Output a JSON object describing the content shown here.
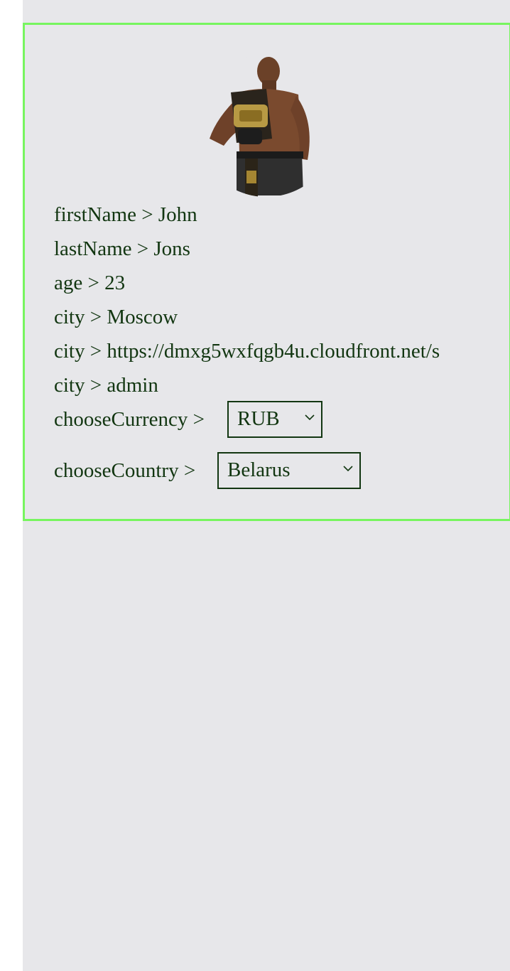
{
  "profile": {
    "fields": [
      {
        "key": "firstName",
        "value": "John"
      },
      {
        "key": "lastName",
        "value": "Jons"
      },
      {
        "key": "age",
        "value": "23"
      },
      {
        "key": "city",
        "value": "Moscow"
      },
      {
        "key": "city",
        "value": "https://dmxg5wxfqgb4u.cloudfront.net/s"
      },
      {
        "key": "city",
        "value": "admin"
      }
    ],
    "separator": ">",
    "avatar_icon": "fighter-photo-icon"
  },
  "currency": {
    "label": "chooseCurrency >",
    "selected": "RUB"
  },
  "country": {
    "label": "chooseCountry >",
    "selected": "Belarus"
  },
  "colors": {
    "border": "#77f55f",
    "text": "#123611",
    "background": "#e7e7ea"
  }
}
